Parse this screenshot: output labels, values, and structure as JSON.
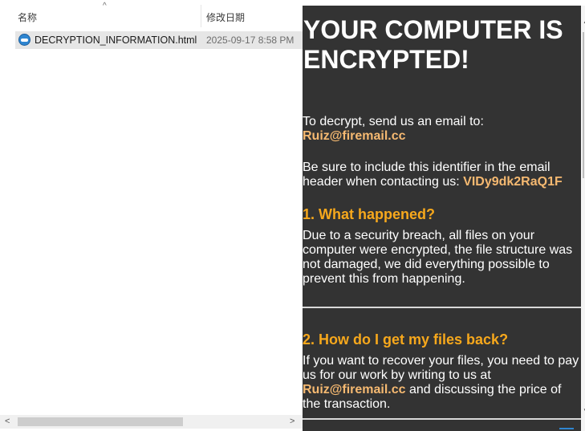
{
  "explorer": {
    "columns": {
      "name": "名称",
      "date": "修改日期"
    },
    "sort_arrow": "^",
    "files": [
      {
        "name": "DECRYPTION_INFORMATION.html",
        "date": "2025-09-17 8:58 PM",
        "icon": "html-file-icon"
      }
    ],
    "scroll": {
      "left": "<",
      "right": ">"
    }
  },
  "note": {
    "title": "YOUR COMPUTER IS ENCRYPTED!",
    "decrypt_text": "To decrypt, send us an email to:",
    "email": "Ruiz@firemail.cc",
    "identifier_text": "Be sure to include this identifier in the email header when contacting us:",
    "identifier": "VIDy9dk2RaQ1F",
    "section1_heading": "1. What happened?",
    "section1_body": "Due to a security breach, all files on your computer were encrypted, the file structure was not damaged, we did everything possible to prevent this from happening.",
    "section2_heading": "2. How do I get my files back?",
    "section2_body_before": "If you want to recover your files, you need to pay us for our work by writing to us at",
    "section2_email": "Ruiz@firemail.cc",
    "section2_body_after": "and discussing the price of the transaction."
  },
  "colors": {
    "note_bg": "#333333",
    "accent_orange": "#f7a81c",
    "email_color": "#f5b971"
  }
}
